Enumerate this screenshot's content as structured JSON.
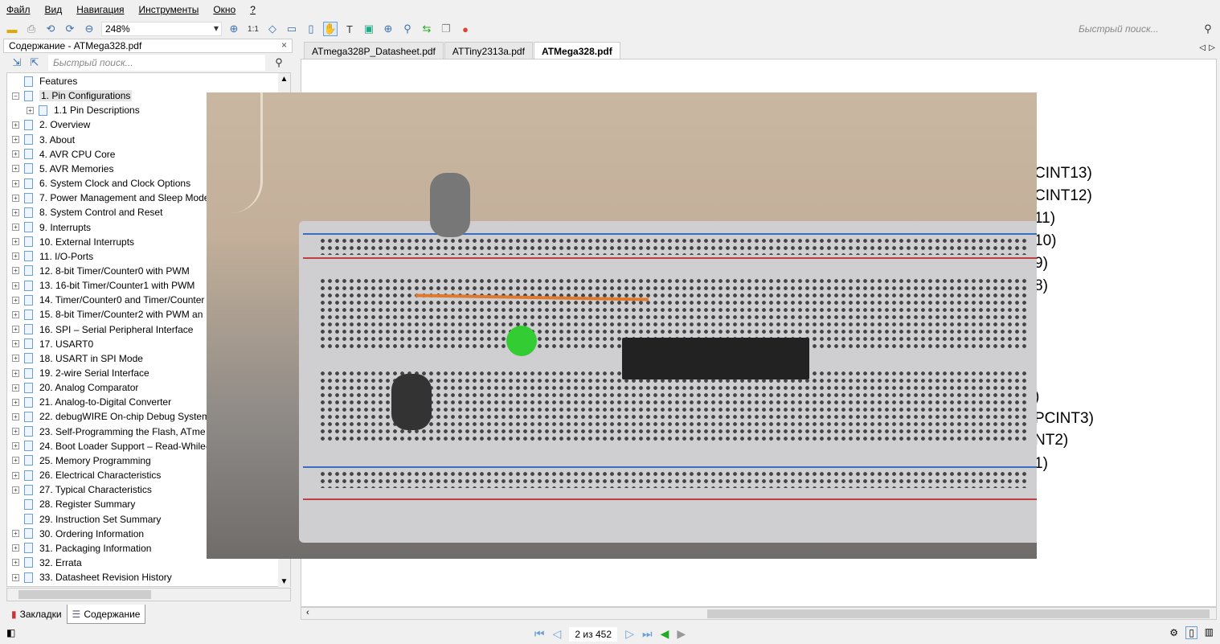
{
  "menu": [
    "Файл",
    "Вид",
    "Навигация",
    "Инструменты",
    "Окно",
    "?"
  ],
  "toolbar": {
    "zoom_value": "248%",
    "quick_search_placeholder": "Быстрый поиск...",
    "icons": [
      "open-folder-icon",
      "print-icon",
      "rotate-left-icon",
      "rotate-right-icon",
      "zoom-out-icon",
      "zoom-in-icon",
      "actual-size-icon",
      "fit-page-icon",
      "fit-width-icon",
      "fit-height-icon",
      "hand-tool-icon",
      "text-select-icon",
      "image-select-icon",
      "zoom-tool-icon",
      "find-icon",
      "sync-icon",
      "copy-icon",
      "bookmark-add-icon"
    ]
  },
  "panel": {
    "title": "Содержание - ATMega328.pdf",
    "close": "×",
    "search_placeholder": "Быстрый поиск...",
    "tree": [
      {
        "label": "Features",
        "level": 0,
        "expandable": false
      },
      {
        "label": "1. Pin Configurations",
        "level": 0,
        "expanded": true,
        "selected": true
      },
      {
        "label": "1.1 Pin Descriptions",
        "level": 1,
        "expandable": true
      },
      {
        "label": "2. Overview",
        "level": 0
      },
      {
        "label": "3. About",
        "level": 0
      },
      {
        "label": "4. AVR CPU Core",
        "level": 0
      },
      {
        "label": "5. AVR Memories",
        "level": 0
      },
      {
        "label": "6. System Clock and Clock Options",
        "level": 0
      },
      {
        "label": "7. Power Management and Sleep Mode",
        "level": 0
      },
      {
        "label": "8. System Control and Reset",
        "level": 0
      },
      {
        "label": "9. Interrupts",
        "level": 0
      },
      {
        "label": "10. External Interrupts",
        "level": 0
      },
      {
        "label": "11. I/O-Ports",
        "level": 0
      },
      {
        "label": "12. 8-bit Timer/Counter0 with PWM",
        "level": 0
      },
      {
        "label": "13. 16-bit Timer/Counter1 with PWM",
        "level": 0
      },
      {
        "label": "14. Timer/Counter0 and Timer/Counter",
        "level": 0
      },
      {
        "label": "15. 8-bit Timer/Counter2 with PWM an",
        "level": 0
      },
      {
        "label": "16. SPI – Serial Peripheral Interface",
        "level": 0
      },
      {
        "label": "17. USART0",
        "level": 0
      },
      {
        "label": "18. USART in SPI Mode",
        "level": 0
      },
      {
        "label": "19. 2-wire Serial Interface",
        "level": 0
      },
      {
        "label": "20. Analog Comparator",
        "level": 0
      },
      {
        "label": "21. Analog-to-Digital Converter",
        "level": 0
      },
      {
        "label": "22. debugWIRE On-chip Debug System",
        "level": 0
      },
      {
        "label": "23. Self-Programming the Flash, ATme",
        "level": 0
      },
      {
        "label": "24. Boot Loader Support – Read-While-",
        "level": 0
      },
      {
        "label": "25. Memory Programming",
        "level": 0
      },
      {
        "label": "26. Electrical Characteristics",
        "level": 0
      },
      {
        "label": "27. Typical Characteristics",
        "level": 0
      },
      {
        "label": "28. Register Summary",
        "level": 0,
        "expandable": false
      },
      {
        "label": "29. Instruction Set Summary",
        "level": 0,
        "expandable": false
      },
      {
        "label": "30. Ordering Information",
        "level": 0
      },
      {
        "label": "31. Packaging Information",
        "level": 0
      },
      {
        "label": "32. Errata",
        "level": 0
      },
      {
        "label": "33. Datasheet Revision History",
        "level": 0
      }
    ],
    "bottom_tabs": [
      "Закладки",
      "Содержание"
    ]
  },
  "tabs": [
    {
      "label": "ATmega328P_Datasheet.pdf"
    },
    {
      "label": "ATTiny2313a.pdf"
    },
    {
      "label": "ATMega328.pdf",
      "active": true
    }
  ],
  "pdf_fragments": [
    "CINT13)",
    "CINT12)",
    "11)",
    "10)",
    "9)",
    "8)",
    ")",
    "PCINT3)",
    "NT2)",
    "1)"
  ],
  "status": {
    "page": "2 из 452"
  }
}
